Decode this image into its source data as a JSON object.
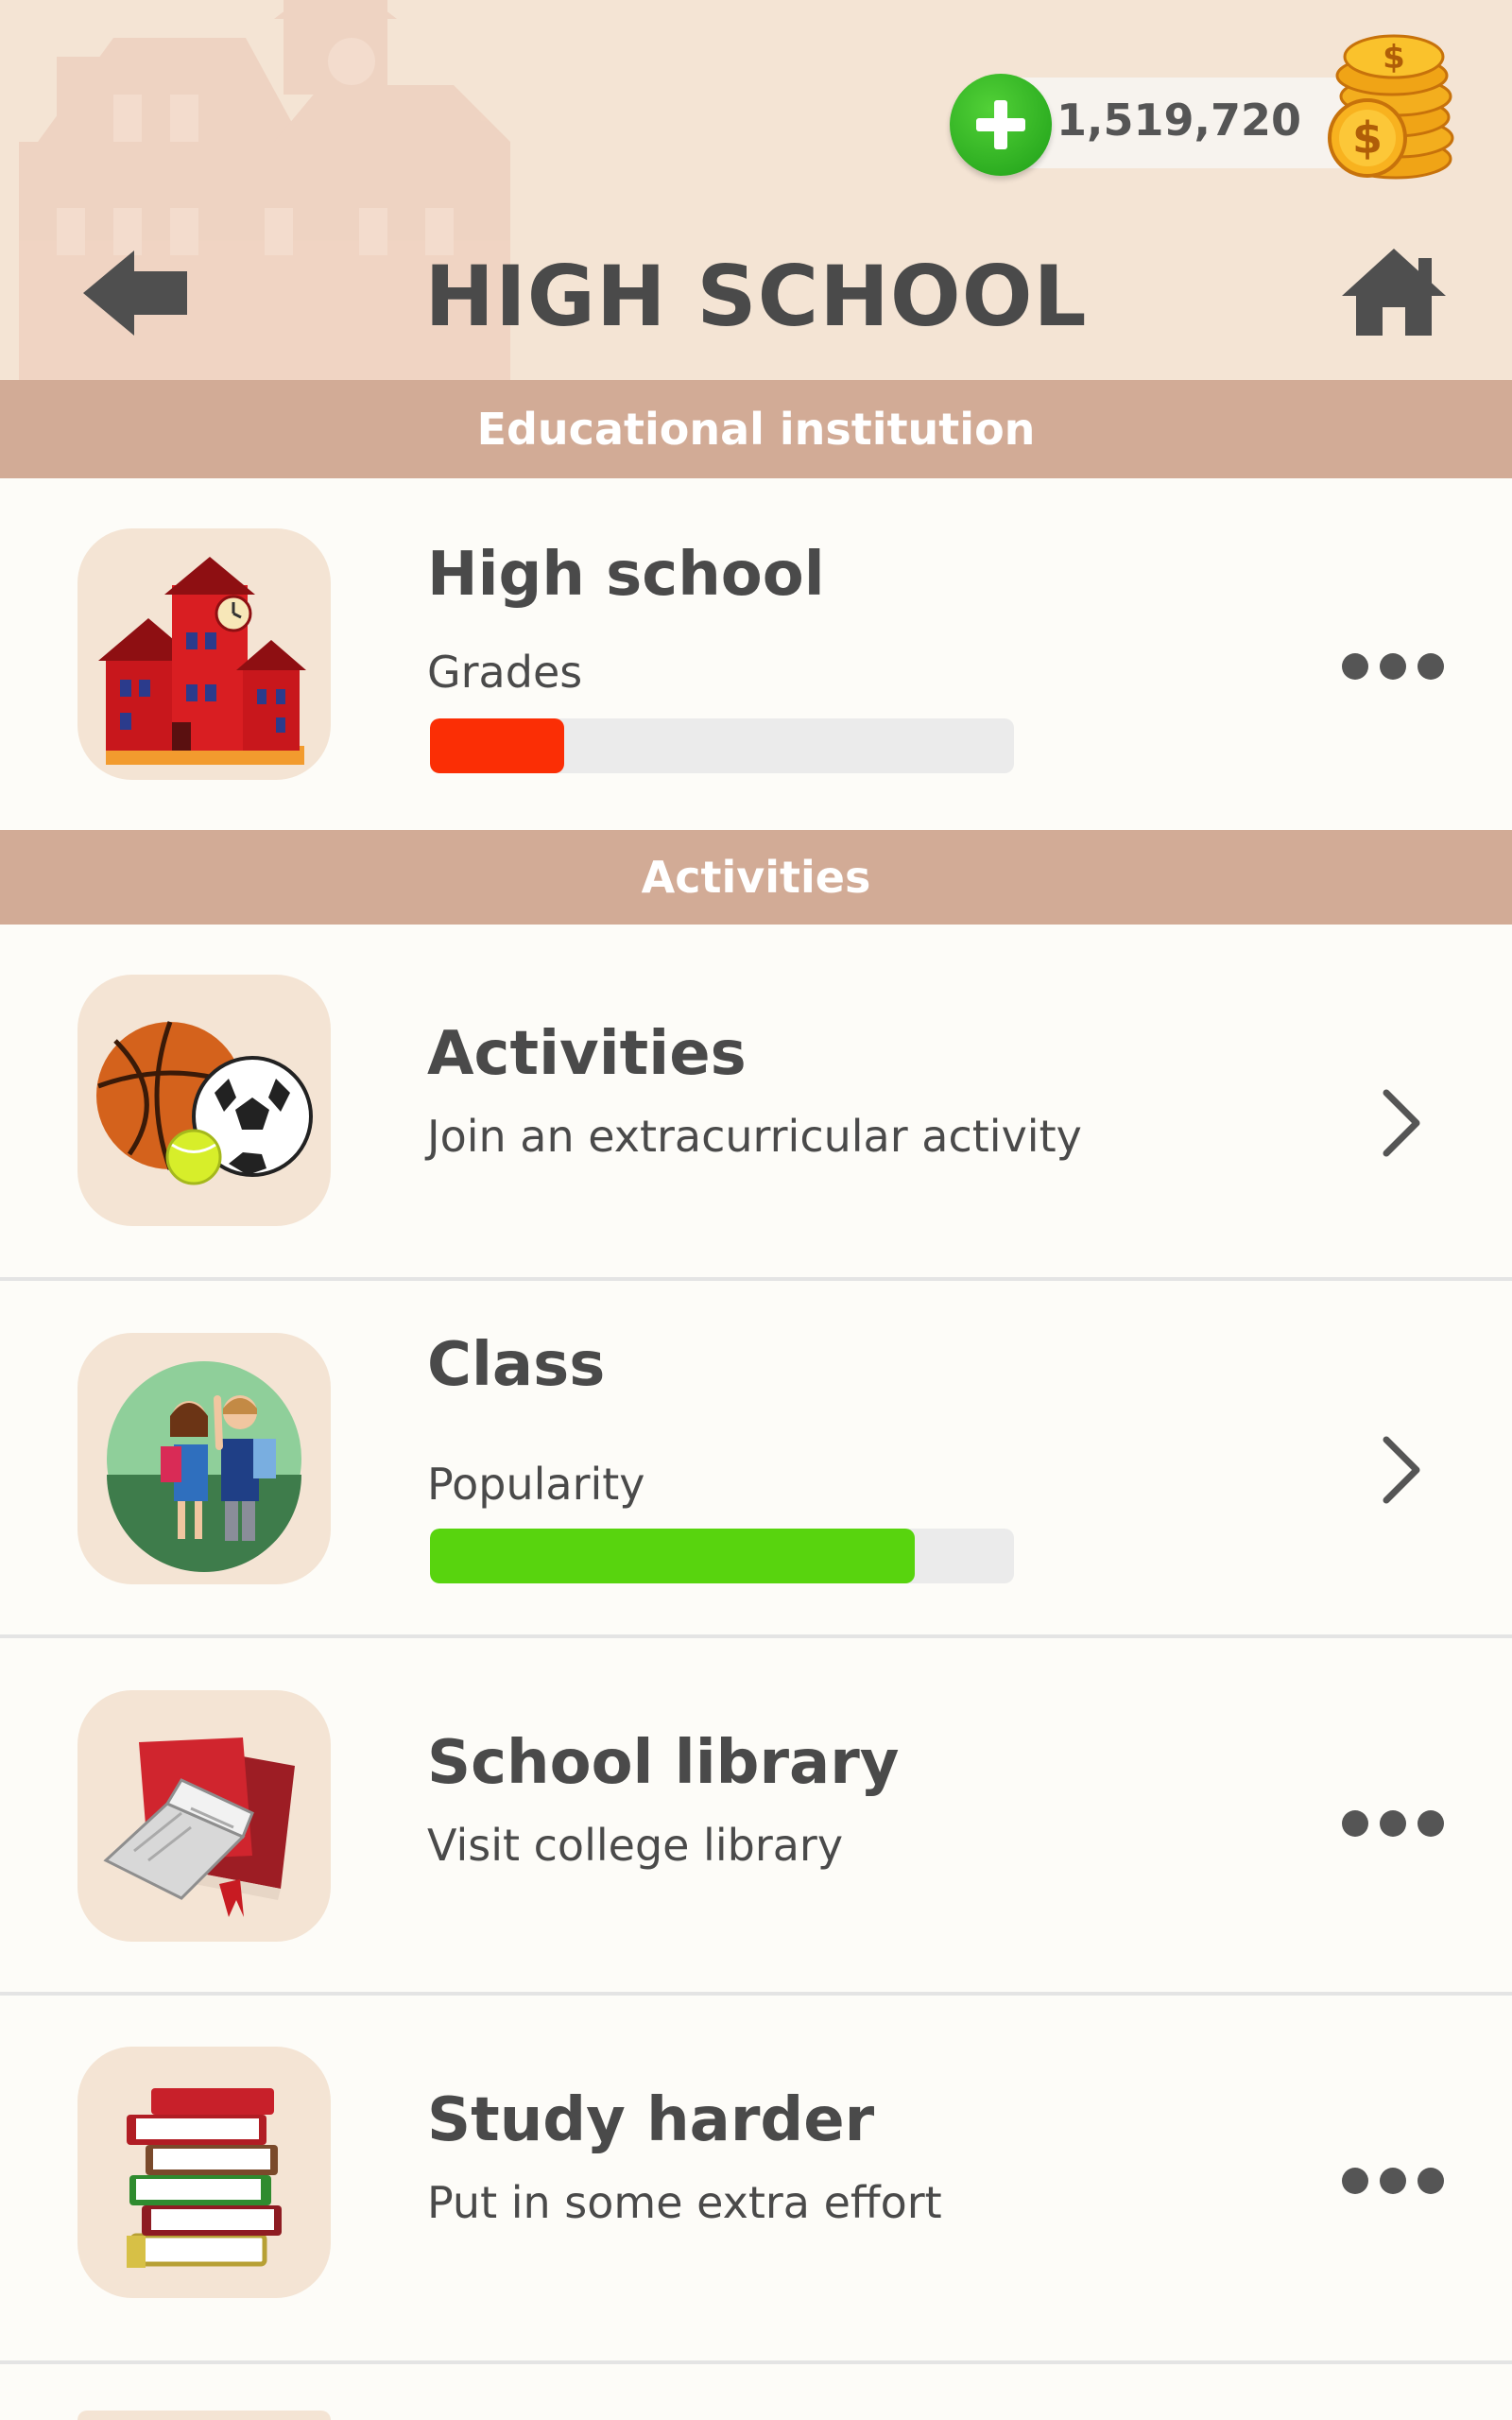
{
  "header": {
    "title": "HIGH SCHOOL",
    "coins": "1,519,720",
    "icons": {
      "back": "arrow-left-icon",
      "home": "home-icon",
      "add": "plus-icon",
      "coins": "coin-stack-icon"
    }
  },
  "sections": [
    {
      "label": "Educational institution"
    },
    {
      "label": "Activities"
    }
  ],
  "rows": [
    {
      "title": "High school",
      "subtitle": "Grades",
      "icon": "school-building-icon",
      "action": "more-options",
      "progress": 0.23,
      "progress_color": "#fb2e05"
    },
    {
      "title": "Activities",
      "subtitle": "Join an extracurricular activity",
      "icon": "sports-balls-icon",
      "action": "chevron-right"
    },
    {
      "title": "Class",
      "subtitle": "Popularity",
      "icon": "students-icon",
      "action": "chevron-right",
      "progress": 0.83,
      "progress_color": "#58d40e"
    },
    {
      "title": "School library",
      "subtitle": "Visit college library",
      "icon": "books-icon",
      "action": "more-options"
    },
    {
      "title": "Study harder",
      "subtitle": "Put in some extra effort",
      "icon": "book-stack-icon",
      "action": "more-options"
    }
  ],
  "colors": {
    "header_bg": "#f4e4d4",
    "section_bg": "#d2ab96",
    "text": "#4a4a4a"
  }
}
